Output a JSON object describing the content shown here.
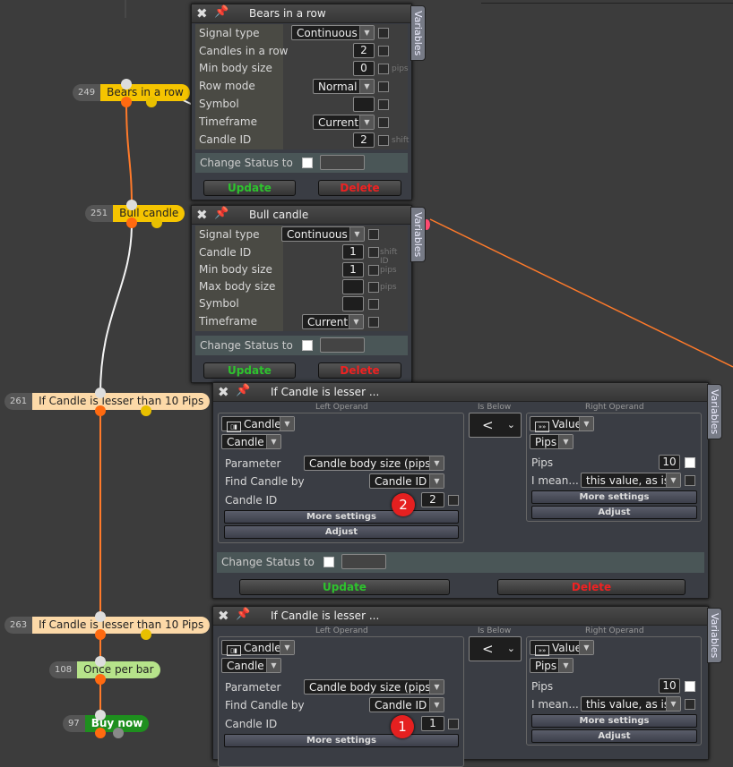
{
  "nodes": [
    {
      "num": "249",
      "label": "Bears in a row"
    },
    {
      "num": "251",
      "label": "Bull candle"
    },
    {
      "num": "261",
      "label": "If Candle is lesser than 10 Pips"
    },
    {
      "num": "263",
      "label": "If Candle is lesser than 10 Pips"
    },
    {
      "num": "108",
      "label": "Once per bar"
    },
    {
      "num": "97",
      "label": "Buy now"
    }
  ],
  "panel1": {
    "title": "Bears in a row",
    "variables": "Variables",
    "labels": [
      "Signal type",
      "Candles in a row",
      "Min body size",
      "Row mode",
      "Symbol",
      "Timeframe",
      "Candle ID"
    ],
    "signal_type": "Continuous",
    "candles": "2",
    "min_body": "0",
    "row_mode": "Normal",
    "symbol": "",
    "timeframe": "Current",
    "candle_id": "2",
    "unit_pips": "pips",
    "unit_shift": "shift",
    "change_status": "Change Status to",
    "update": "Update",
    "delete": "Delete"
  },
  "panel2": {
    "title": "Bull candle",
    "variables": "Variables",
    "labels": [
      "Signal type",
      "Candle ID",
      "Min body size",
      "Max body size",
      "Symbol",
      "Timeframe"
    ],
    "signal_type": "Continuous",
    "candle_id": "1",
    "min_body": "1",
    "max_body": "",
    "symbol": "",
    "timeframe": "Current",
    "unit_shift": "shift ID",
    "unit_pips": "pips",
    "change_status": "Change Status to",
    "update": "Update",
    "delete": "Delete"
  },
  "panel3": {
    "title": "If Candle is lesser ...",
    "variables": "Variables",
    "left_caption": "Left Operand",
    "mid_caption": "Is Below",
    "right_caption": "Right Operand",
    "lsel1": "Candle",
    "lsel2": "Candle",
    "parameter_label": "Parameter",
    "parameter": "Candle body size (pips)",
    "find_label": "Find Candle by",
    "find": "Candle ID",
    "cid_label": "Candle ID",
    "cid": "2",
    "more": "More settings",
    "adjust": "Adjust",
    "op": "<",
    "rsel1": "Value",
    "rsel2": "Pips",
    "pips_label": "Pips",
    "pips": "10",
    "mean_label": "I mean...",
    "mean": "this value, as is",
    "badge": "2",
    "change_status": "Change Status to",
    "update": "Update",
    "delete": "Delete"
  },
  "panel4": {
    "title": "If Candle is lesser ...",
    "variables": "Variables",
    "left_caption": "Left Operand",
    "mid_caption": "Is Below",
    "right_caption": "Right Operand",
    "lsel1": "Candle",
    "lsel2": "Candle",
    "parameter_label": "Parameter",
    "parameter": "Candle body size (pips)",
    "find_label": "Find Candle by",
    "find": "Candle ID",
    "cid_label": "Candle ID",
    "cid": "1",
    "more": "More settings",
    "adjust": "Adjust",
    "op": "<",
    "rsel1": "Value",
    "rsel2": "Pips",
    "pips_label": "Pips",
    "pips": "10",
    "mean_label": "I mean...",
    "mean": "this value, as is",
    "badge": "1"
  },
  "colors": {
    "node_yellow": "#f5c400",
    "node_peach": "#fcd9a8",
    "node_green": "#b6e38a",
    "node_buy": "#1e8f1e",
    "wire_orange": "#ff7a2a",
    "update_green": "#2ec32e",
    "delete_red": "#e22222"
  }
}
